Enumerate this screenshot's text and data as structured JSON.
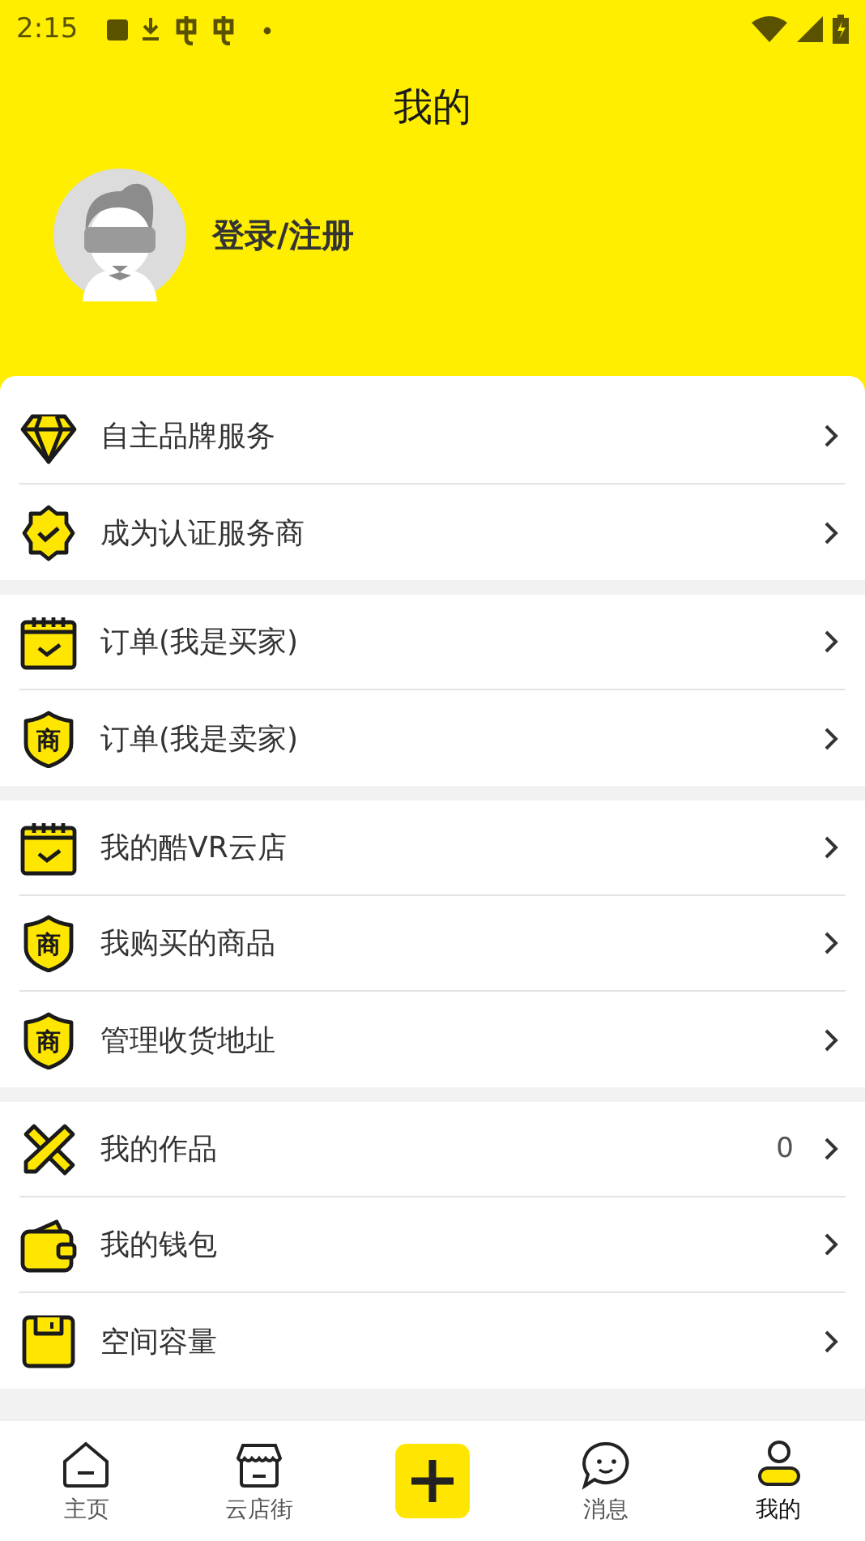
{
  "status_bar": {
    "time": "2:15"
  },
  "header": {
    "title": "我的"
  },
  "profile": {
    "login_label": "登录/注册"
  },
  "groups": [
    [
      {
        "label": "自主品牌服务",
        "kind": "diamond"
      },
      {
        "label": "成为认证服务商",
        "kind": "badge"
      }
    ],
    [
      {
        "label": "订单(我是买家)",
        "kind": "calendar"
      },
      {
        "label": "订单(我是卖家)",
        "kind": "shield",
        "icon_text": "商"
      }
    ],
    [
      {
        "label": "我的酷VR云店",
        "kind": "calendar"
      },
      {
        "label": "我购买的商品",
        "kind": "shield",
        "icon_text": "商"
      },
      {
        "label": "管理收货地址",
        "kind": "shield",
        "icon_text": "商"
      }
    ],
    [
      {
        "label": "我的作品",
        "kind": "pencil",
        "count": "0"
      },
      {
        "label": "我的钱包",
        "kind": "wallet"
      },
      {
        "label": "空间容量",
        "kind": "floppy"
      }
    ]
  ],
  "bottom_nav": [
    {
      "label": "主页",
      "kind": "home",
      "selected": false
    },
    {
      "label": "云店街",
      "kind": "store",
      "selected": false
    },
    {
      "kind": "add",
      "selected": false
    },
    {
      "label": "消息",
      "kind": "message",
      "selected": false
    },
    {
      "label": "我的",
      "kind": "profile",
      "selected": true
    }
  ]
}
